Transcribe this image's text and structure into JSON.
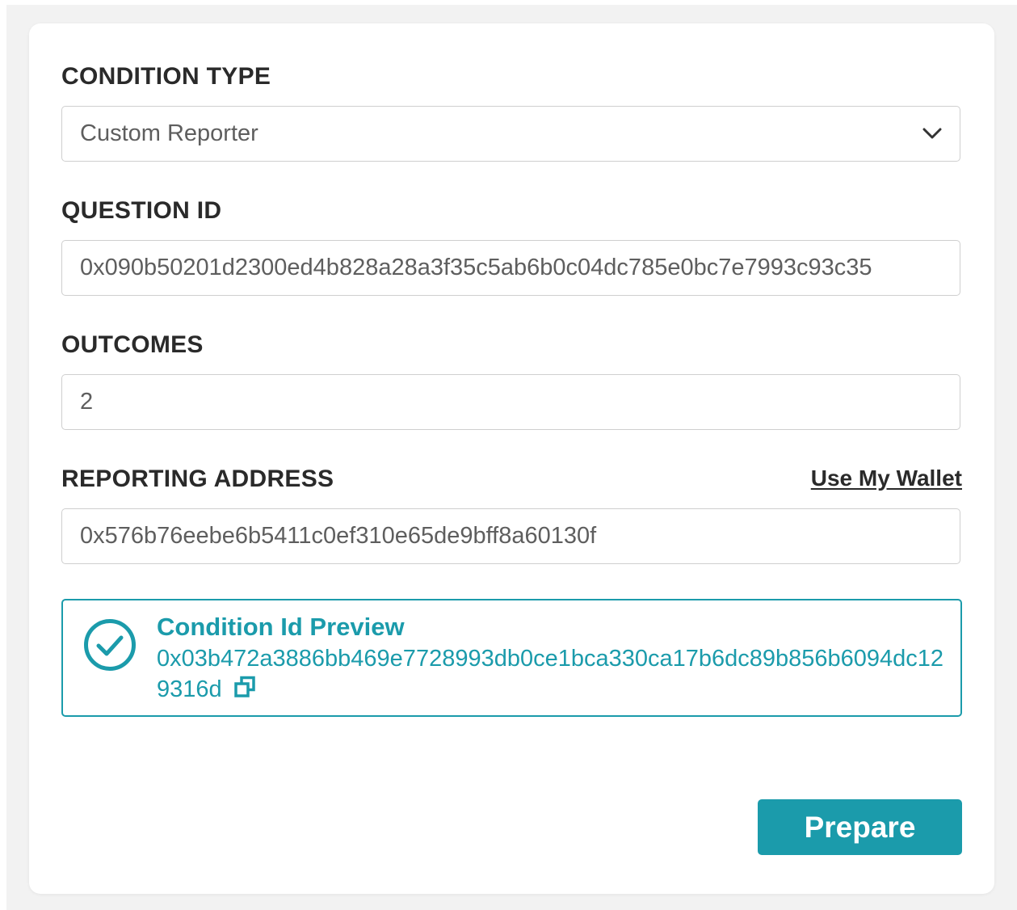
{
  "form": {
    "condition_type": {
      "label": "CONDITION TYPE",
      "value": "Custom Reporter",
      "icon": "chevron-down-icon"
    },
    "question_id": {
      "label": "QUESTION ID",
      "value": "0x090b50201d2300ed4b828a28a3f35c5ab6b0c04dc785e0bc7e7993c93c35"
    },
    "outcomes": {
      "label": "OUTCOMES",
      "value": "2"
    },
    "reporting_address": {
      "label": "REPORTING ADDRESS",
      "value": "0x576b76eebe6b5411c0ef310e65de9bff8a60130f",
      "use_wallet_link": "Use My Wallet"
    },
    "preview": {
      "title": "Condition Id Preview",
      "value": "0x03b472a3886bb469e7728993db0ce1bca330ca17b6dc89b856b6094dc129316d",
      "status_icon": "check-circle-icon",
      "copy_icon": "copy-icon"
    },
    "prepare_button": "Prepare"
  },
  "colors": {
    "accent": "#1b9bab",
    "label_text": "#2a2a2a",
    "field_text": "#5e5e5e",
    "border": "#cfcfcf",
    "page_background": "#f2f2f2"
  }
}
